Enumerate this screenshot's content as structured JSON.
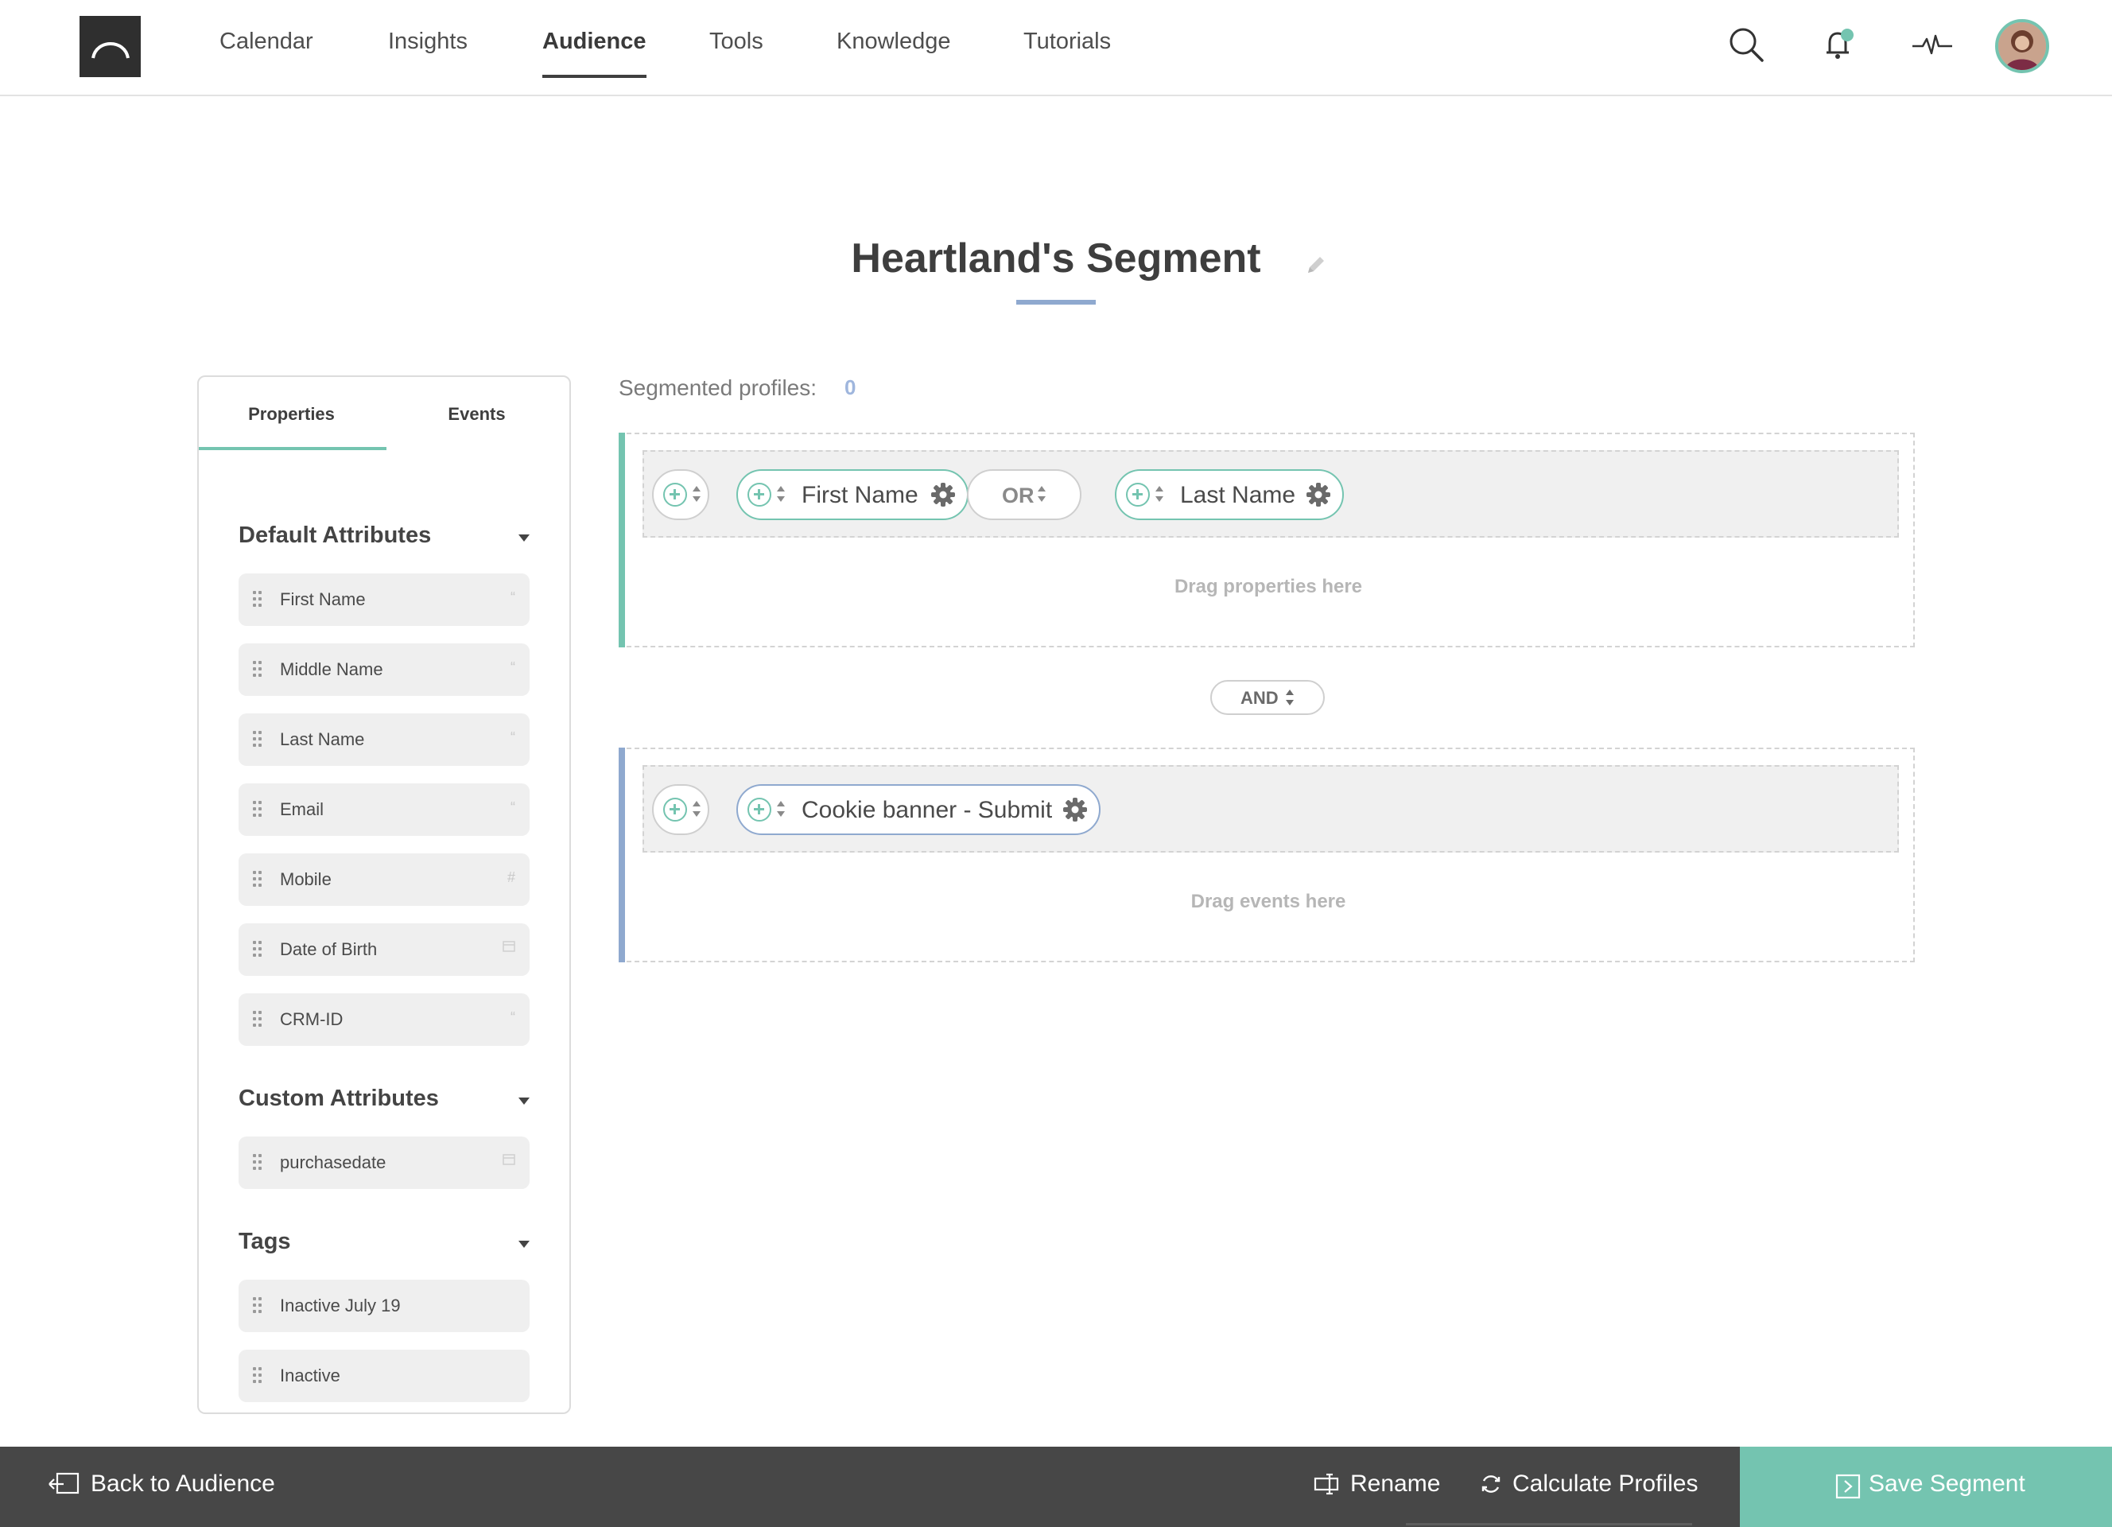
{
  "nav": {
    "items": [
      {
        "label": "Calendar",
        "active": false
      },
      {
        "label": "Insights",
        "active": false
      },
      {
        "label": "Audience",
        "active": true
      },
      {
        "label": "Tools",
        "active": false
      },
      {
        "label": "Knowledge",
        "active": false
      },
      {
        "label": "Tutorials",
        "active": false
      }
    ],
    "icons": [
      "search-icon",
      "bell-icon",
      "activity-icon",
      "avatar"
    ],
    "notification_dot_color": "#74c4b0"
  },
  "page": {
    "title": "Heartland's Segment"
  },
  "panel": {
    "tabs": [
      "Properties",
      "Events"
    ],
    "active_tab": "Properties",
    "sections": [
      {
        "title": "Default Attributes",
        "items": [
          {
            "label": "First Name",
            "type_icon": "quote-icon"
          },
          {
            "label": "Middle Name",
            "type_icon": "quote-icon"
          },
          {
            "label": "Last Name",
            "type_icon": "quote-icon"
          },
          {
            "label": "Email",
            "type_icon": "quote-icon"
          },
          {
            "label": "Mobile",
            "type_icon": "hash-icon"
          },
          {
            "label": "Date of Birth",
            "type_icon": "calendar-icon"
          },
          {
            "label": "CRM-ID",
            "type_icon": "quote-icon"
          }
        ]
      },
      {
        "title": "Custom Attributes",
        "items": [
          {
            "label": "purchasedate",
            "type_icon": "calendar-icon"
          }
        ]
      },
      {
        "title": "Tags",
        "items": [
          {
            "label": "Inactive July 19"
          },
          {
            "label": "Inactive"
          }
        ]
      }
    ]
  },
  "builder": {
    "segmented_label": "Segmented profiles:",
    "segmented_count": "0",
    "property_group": {
      "conditions": [
        "First Name",
        "Last Name"
      ],
      "operator": "OR",
      "drop_hint": "Drag properties here"
    },
    "group_join": "AND",
    "event_group": {
      "conditions": [
        "Cookie banner - Submit"
      ],
      "drop_hint": "Drag events here"
    }
  },
  "footer": {
    "back": "Back to Audience",
    "rename": "Rename",
    "calculate": "Calculate Profiles",
    "save": "Save Segment"
  },
  "colors": {
    "accent_teal": "#74c4b0",
    "accent_blue": "#8fa9cf",
    "footer_bg": "#474747"
  }
}
